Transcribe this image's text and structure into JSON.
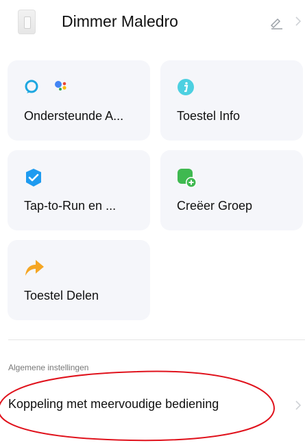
{
  "header": {
    "title": "Dimmer Maledro",
    "edit_icon": "pencil-icon",
    "chevron_icon": "chevron-right-icon"
  },
  "cards": [
    {
      "label": "Ondersteunde A...",
      "icons": [
        "alexa-icon",
        "google-assistant-icon"
      ]
    },
    {
      "label": "Toestel Info",
      "icon": "info-icon",
      "icon_color": "#4dd0e1"
    },
    {
      "label": "Tap-to-Run en ...",
      "icon": "tap-to-run-icon",
      "icon_color": "#1e9bf0"
    },
    {
      "label": "Creëer Groep",
      "icon": "group-add-icon",
      "icon_color": "#3fb950"
    },
    {
      "label": "Toestel Delen",
      "icon": "share-arrow-icon",
      "icon_color": "#f5a623"
    }
  ],
  "general": {
    "section_title": "Algemene instellingen",
    "items": [
      {
        "label": "Koppeling met meervoudige bediening",
        "icon": "chevron-right-icon"
      }
    ]
  },
  "colors": {
    "card_background": "#f5f6fa",
    "annotation": "#e0121c"
  }
}
